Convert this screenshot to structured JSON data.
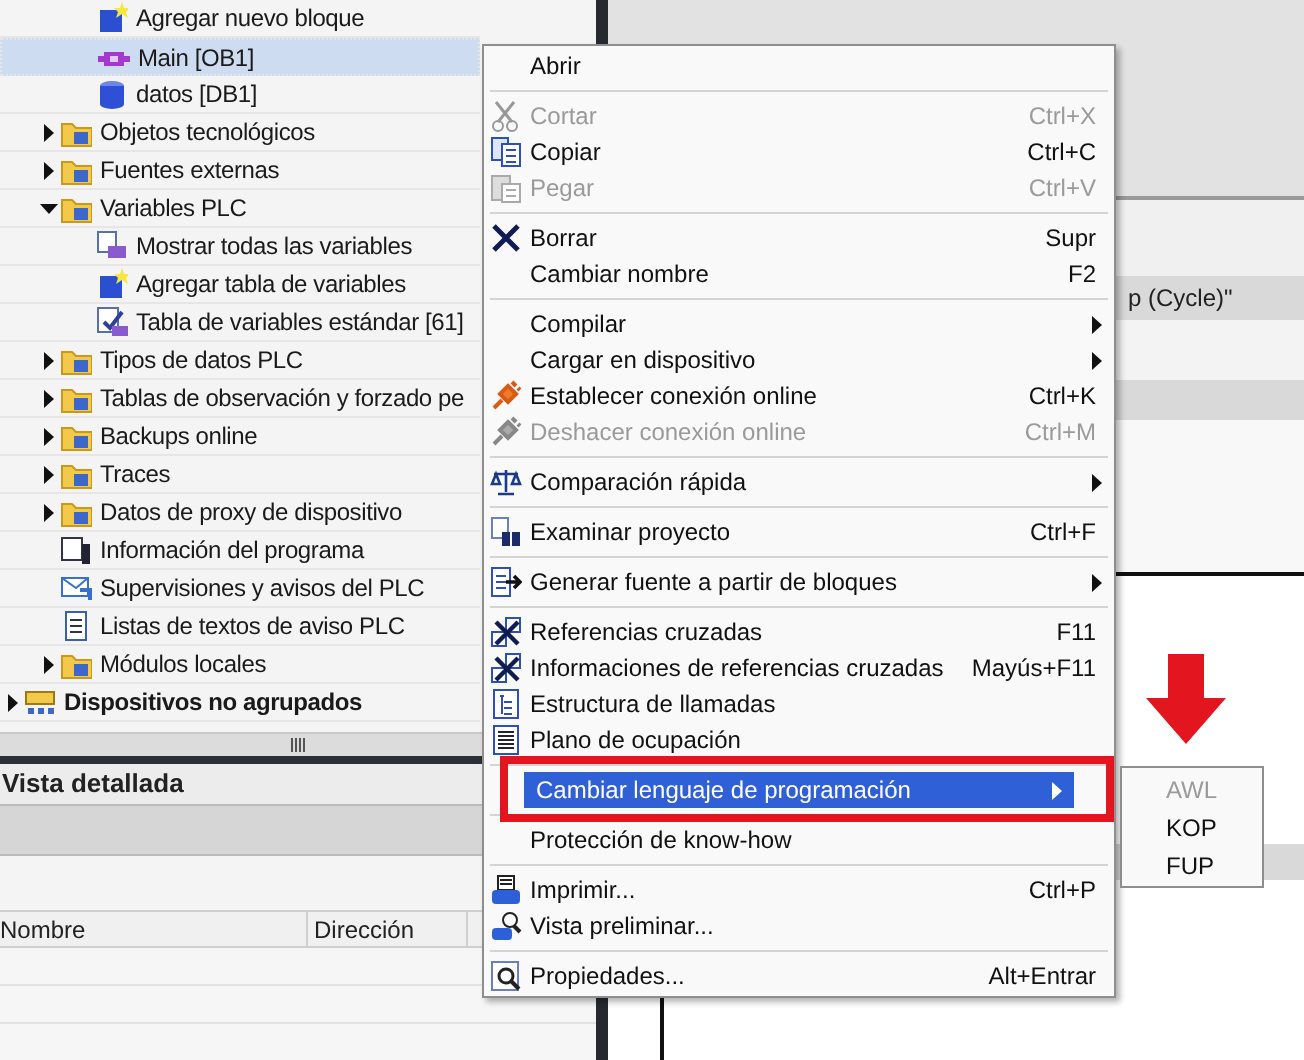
{
  "tree": [
    {
      "children": [
        {
          "children": [
            {
              "label": "Agregar nuevo bloque",
              "selected": false
            },
            {
              "label": "Main [OB1]",
              "selected": true
            },
            {
              "label": "datos [DB1]",
              "selected": false
            }
          ]
        },
        {
          "label": "Objetos tecnológicos",
          "expanded": false,
          "selected": false
        },
        {
          "label": "Fuentes externas",
          "expanded": false,
          "selected": false
        },
        {
          "label": "Variables PLC",
          "expanded": true,
          "selected": false,
          "children": [
            {
              "label": "Mostrar todas las variables",
              "selected": false
            },
            {
              "label": "Agregar tabla de variables",
              "selected": false
            },
            {
              "label": "Tabla de variables estándar [61]",
              "selected": false
            }
          ]
        },
        {
          "label": "Tipos de datos PLC",
          "expanded": false,
          "selected": false
        },
        {
          "label": "Tablas de observación y forzado pe",
          "expanded": false,
          "selected": false
        },
        {
          "label": "Backups online",
          "expanded": false,
          "selected": false
        },
        {
          "label": "Traces",
          "expanded": false,
          "selected": false
        },
        {
          "label": "Datos de proxy de dispositivo",
          "expanded": false,
          "selected": false
        },
        {
          "label": "Información del programa",
          "selected": false
        },
        {
          "label": "Supervisiones y avisos del PLC",
          "selected": false
        },
        {
          "label": "Listas de textos de aviso PLC",
          "selected": false
        },
        {
          "label": "Módulos locales",
          "expanded": false,
          "selected": false
        }
      ]
    },
    {
      "label": "Dispositivos no agrupados",
      "expanded": false,
      "selected": false
    }
  ],
  "detail_view": {
    "title": "Vista detallada",
    "columns": [
      "Nombre",
      "Dirección"
    ]
  },
  "editor": {
    "header": "p (Cycle)\""
  },
  "context_menu": [
    [
      {
        "label": "Abrir",
        "disabled": false,
        "selected": false
      }
    ],
    [
      {
        "label": "Cortar",
        "shortcut": "Ctrl+X",
        "disabled": true,
        "selected": false
      },
      {
        "label": "Copiar",
        "shortcut": "Ctrl+C",
        "disabled": false,
        "selected": false
      },
      {
        "label": "Pegar",
        "shortcut": "Ctrl+V",
        "disabled": true,
        "selected": false
      }
    ],
    [
      {
        "label": "Borrar",
        "shortcut": "Supr",
        "disabled": false,
        "selected": false
      },
      {
        "label": "Cambiar nombre",
        "shortcut": "F2",
        "disabled": false,
        "selected": false
      }
    ],
    [
      {
        "label": "Compilar",
        "submenu": true,
        "disabled": false,
        "selected": false
      },
      {
        "label": "Cargar en dispositivo",
        "submenu": true,
        "disabled": false,
        "selected": false
      },
      {
        "label": "Establecer conexión online",
        "shortcut": "Ctrl+K",
        "disabled": false,
        "selected": false
      },
      {
        "label": "Deshacer conexión online",
        "shortcut": "Ctrl+M",
        "disabled": true,
        "selected": false
      }
    ],
    [
      {
        "label": "Comparación rápida",
        "submenu": true,
        "disabled": false,
        "selected": false
      }
    ],
    [
      {
        "label": "Examinar proyecto",
        "shortcut": "Ctrl+F",
        "disabled": false,
        "selected": false
      }
    ],
    [
      {
        "label": "Generar fuente a partir de bloques",
        "submenu": true,
        "disabled": false,
        "selected": false
      }
    ],
    [
      {
        "label": "Referencias cruzadas",
        "shortcut": "F11",
        "disabled": false,
        "selected": false
      },
      {
        "label": "Informaciones de referencias cruzadas",
        "shortcut": "Mayús+F11",
        "disabled": false,
        "selected": false
      },
      {
        "label": "Estructura de llamadas",
        "disabled": false,
        "selected": false
      },
      {
        "label": "Plano de ocupación",
        "disabled": false,
        "selected": false
      }
    ],
    [
      {
        "label": "Cambiar lenguaje de programación",
        "submenu": true,
        "disabled": false,
        "selected": true
      }
    ],
    [
      {
        "label": "Protección de know-how",
        "disabled": false,
        "selected": false
      }
    ],
    [
      {
        "label": "Imprimir...",
        "shortcut": "Ctrl+P",
        "disabled": false,
        "selected": false
      },
      {
        "label": "Vista preliminar...",
        "disabled": false,
        "selected": false
      }
    ],
    [
      {
        "label": "Propiedades...",
        "shortcut": "Alt+Entrar",
        "disabled": false,
        "selected": false
      }
    ]
  ],
  "submenu": [
    {
      "label": "AWL",
      "disabled": true
    },
    {
      "label": "KOP",
      "disabled": false
    },
    {
      "label": "FUP",
      "disabled": false
    }
  ]
}
